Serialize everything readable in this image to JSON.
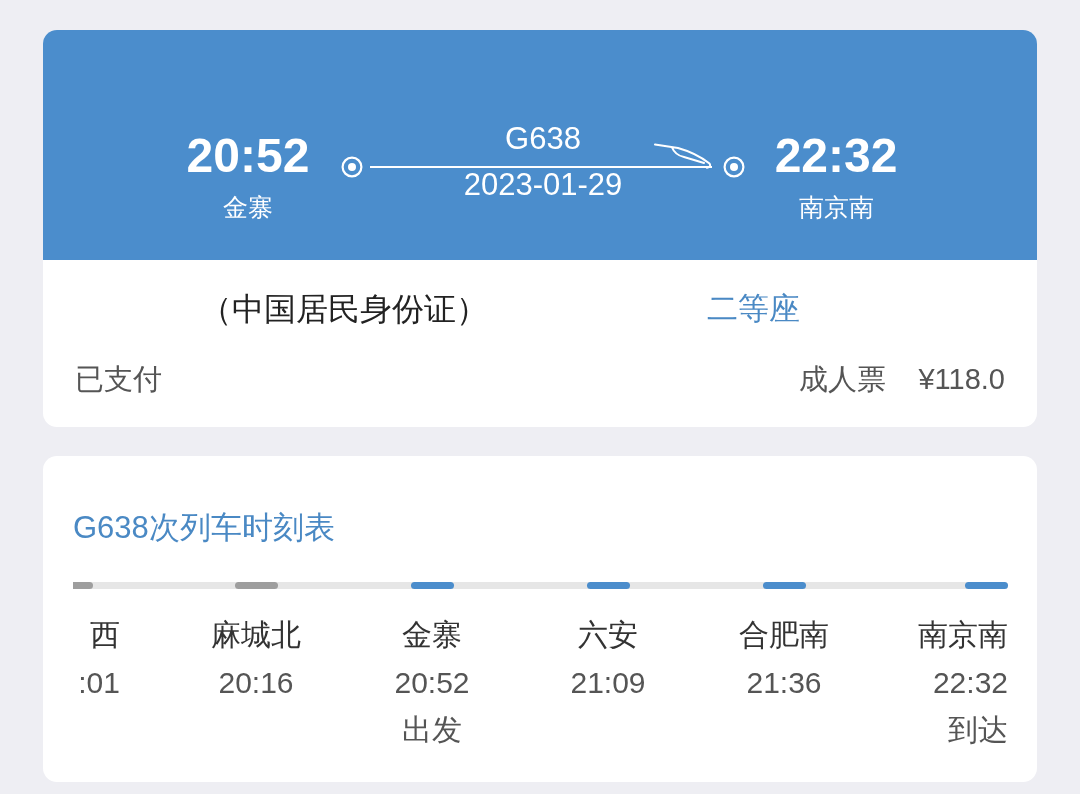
{
  "trip": {
    "departure": {
      "time": "20:52",
      "station": "金寨"
    },
    "train_number": "G638",
    "date": "2023-01-29",
    "arrival": {
      "time": "22:32",
      "station": "南京南"
    }
  },
  "passenger": {
    "id_type": "（中国居民身份证）",
    "seat_class": "二等座",
    "payment_status": "已支付",
    "ticket_type": "成人票",
    "price": "¥118.0"
  },
  "timetable": {
    "title": "G638次列车时刻表",
    "stations": [
      {
        "name": "西",
        "time": ":01",
        "on_route": false
      },
      {
        "name": "麻城北",
        "time": "20:16",
        "on_route": false
      },
      {
        "name": "金寨",
        "time": "20:52",
        "note": "出发",
        "on_route": true
      },
      {
        "name": "六安",
        "time": "21:09",
        "on_route": true
      },
      {
        "name": "合肥南",
        "time": "21:36",
        "on_route": true
      },
      {
        "name": "南京南",
        "time": "22:32",
        "note": "到达",
        "on_route": true
      }
    ]
  }
}
